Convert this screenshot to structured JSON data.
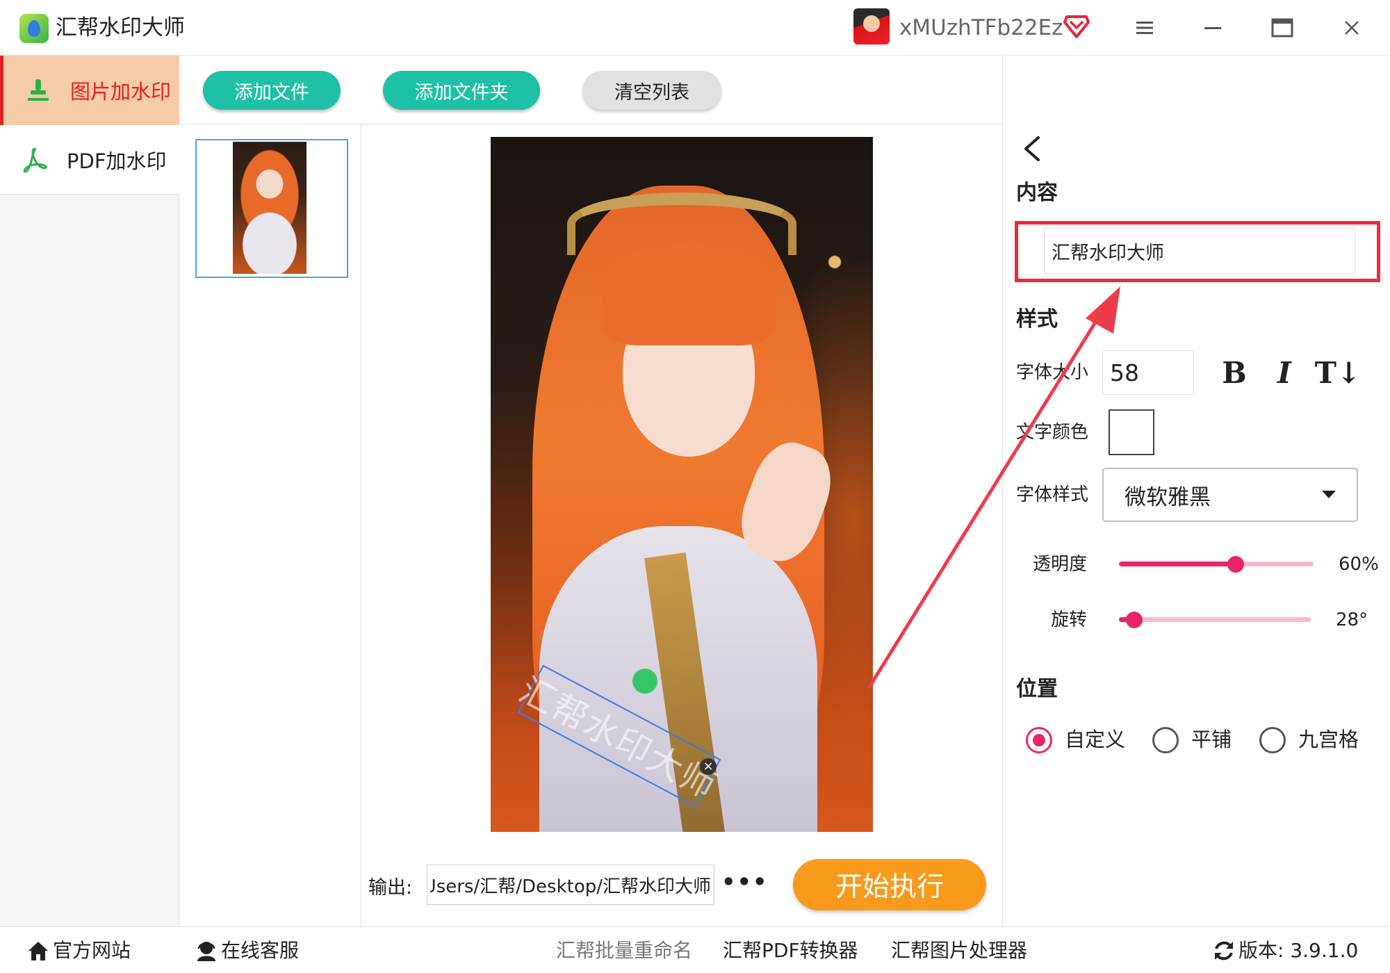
{
  "titlebar": {
    "app_title": "汇帮水印大师",
    "user_name": "xMUzhTFb22Ez"
  },
  "nav": {
    "items": [
      {
        "label": "图片加水印",
        "active": true
      },
      {
        "label": "PDF加水印",
        "active": false
      }
    ]
  },
  "toolbar": {
    "add_file": "添加文件",
    "add_folder": "添加文件夹",
    "clear_list": "清空列表"
  },
  "preview": {
    "watermark_text": "汇帮水印大师"
  },
  "output": {
    "label": "输出:",
    "path": "C:/Users/汇帮/Desktop/汇帮水印大师",
    "more": "•••",
    "start_button": "开始执行"
  },
  "settings": {
    "content_title": "内容",
    "content_value": "汇帮水印大师",
    "style_title": "样式",
    "font_size_label": "字体大小",
    "font_size_value": "58",
    "bold": "B",
    "italic": "I",
    "vertical_text": "T↓",
    "text_color_label": "文字颜色",
    "text_color": "#ffffff",
    "font_style_label": "字体样式",
    "font_style_value": "微软雅黑",
    "opacity_label": "透明度",
    "opacity_value": "60%",
    "opacity_fraction": 0.6,
    "rotation_label": "旋转",
    "rotation_value": "28°",
    "rotation_fraction": 0.078,
    "position_title": "位置",
    "position_options": [
      {
        "label": "自定义",
        "checked": true
      },
      {
        "label": "平铺",
        "checked": false
      },
      {
        "label": "九宫格",
        "checked": false
      }
    ]
  },
  "statusbar": {
    "website": "官方网站",
    "support": "在线客服",
    "link_rename": "汇帮批量重命名",
    "link_pdf": "汇帮PDF转换器",
    "link_image": "汇帮图片处理器",
    "version": "版本: 3.9.1.0"
  },
  "colors": {
    "accent_green": "#1ec0a6",
    "accent_orange": "#f89a1c",
    "accent_pink": "#e8246a",
    "nav_active_bg": "#f6cba7",
    "highlight_red": "#ee2a3a"
  },
  "icons": {
    "nav_image": "stamp-icon",
    "nav_pdf": "pdf-icon",
    "vip": "diamond-icon",
    "website": "home-icon",
    "support": "headset-icon",
    "version": "refresh-icon"
  }
}
